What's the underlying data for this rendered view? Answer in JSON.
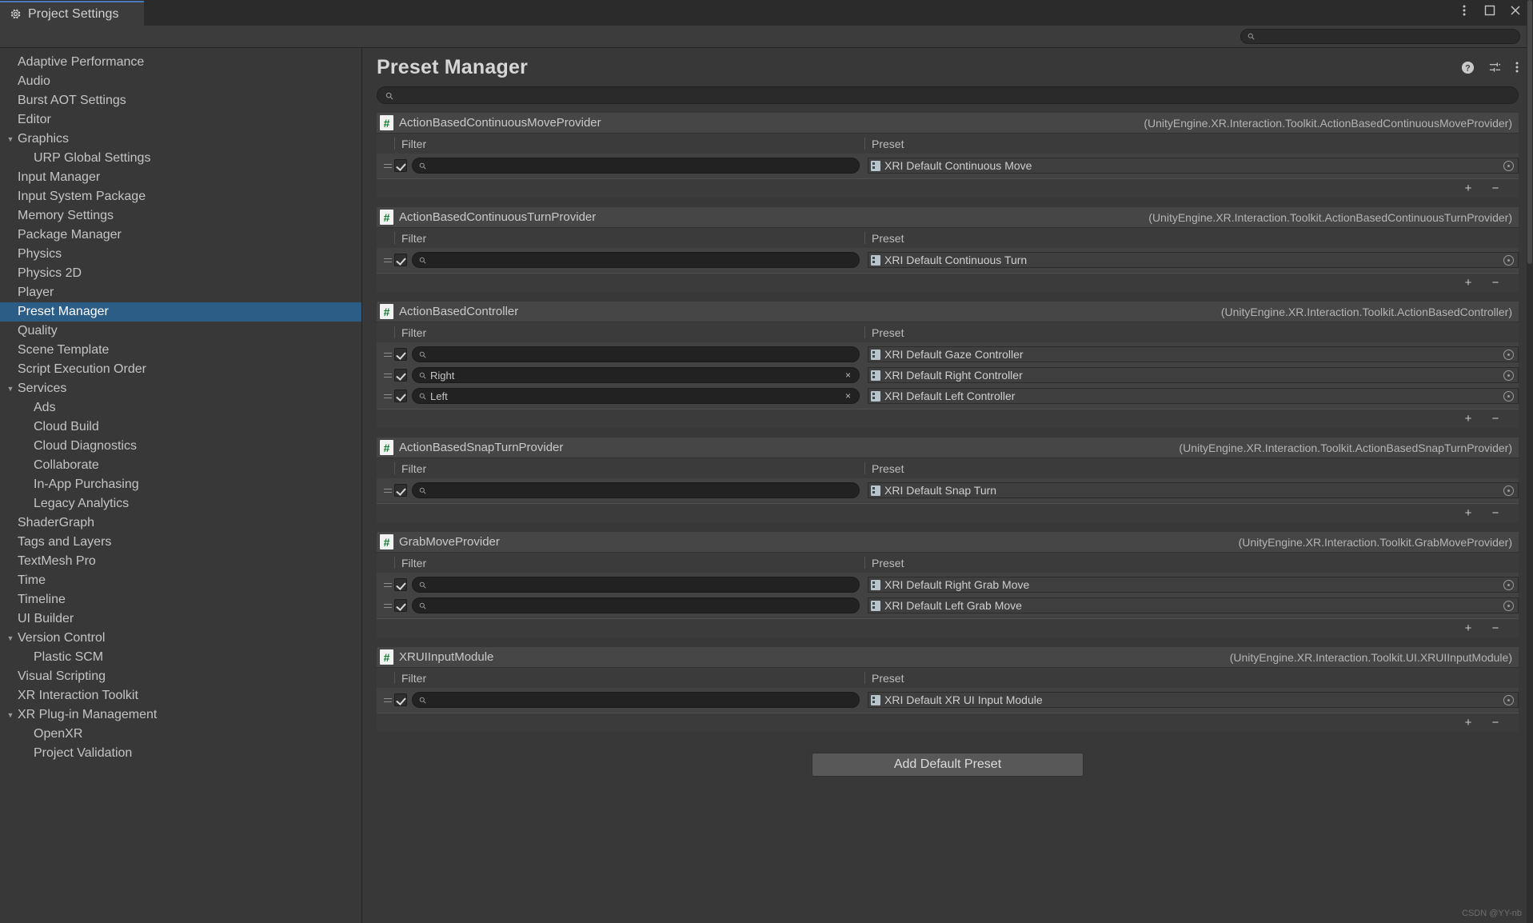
{
  "window": {
    "tab_label": "Project Settings",
    "gear_icon": "gear-icon",
    "menu_icon": "kebab-menu-icon",
    "maximize_icon": "maximize-icon",
    "close_icon": "close-icon"
  },
  "toolbar": {
    "search_value": "",
    "search_placeholder": "",
    "search_icon": "search-icon"
  },
  "header": {
    "title": "Preset Manager",
    "help_icon": "help-icon",
    "settings_icon": "preferences-icon",
    "more_icon": "kebab-menu-icon"
  },
  "panel_search": {
    "value": "",
    "placeholder": "",
    "icon": "search-icon"
  },
  "sidebar": {
    "items": [
      {
        "label": "Adaptive Performance",
        "depth": 0,
        "arrow": "",
        "selected": false
      },
      {
        "label": "Audio",
        "depth": 0,
        "arrow": "",
        "selected": false
      },
      {
        "label": "Burst AOT Settings",
        "depth": 0,
        "arrow": "",
        "selected": false
      },
      {
        "label": "Editor",
        "depth": 0,
        "arrow": "",
        "selected": false
      },
      {
        "label": "Graphics",
        "depth": 0,
        "arrow": "▼",
        "selected": false
      },
      {
        "label": "URP Global Settings",
        "depth": 1,
        "arrow": "",
        "selected": false
      },
      {
        "label": "Input Manager",
        "depth": 0,
        "arrow": "",
        "selected": false
      },
      {
        "label": "Input System Package",
        "depth": 0,
        "arrow": "",
        "selected": false
      },
      {
        "label": "Memory Settings",
        "depth": 0,
        "arrow": "",
        "selected": false
      },
      {
        "label": "Package Manager",
        "depth": 0,
        "arrow": "",
        "selected": false
      },
      {
        "label": "Physics",
        "depth": 0,
        "arrow": "",
        "selected": false
      },
      {
        "label": "Physics 2D",
        "depth": 0,
        "arrow": "",
        "selected": false
      },
      {
        "label": "Player",
        "depth": 0,
        "arrow": "",
        "selected": false
      },
      {
        "label": "Preset Manager",
        "depth": 0,
        "arrow": "",
        "selected": true
      },
      {
        "label": "Quality",
        "depth": 0,
        "arrow": "",
        "selected": false
      },
      {
        "label": "Scene Template",
        "depth": 0,
        "arrow": "",
        "selected": false
      },
      {
        "label": "Script Execution Order",
        "depth": 0,
        "arrow": "",
        "selected": false
      },
      {
        "label": "Services",
        "depth": 0,
        "arrow": "▼",
        "selected": false
      },
      {
        "label": "Ads",
        "depth": 1,
        "arrow": "",
        "selected": false
      },
      {
        "label": "Cloud Build",
        "depth": 1,
        "arrow": "",
        "selected": false
      },
      {
        "label": "Cloud Diagnostics",
        "depth": 1,
        "arrow": "",
        "selected": false
      },
      {
        "label": "Collaborate",
        "depth": 1,
        "arrow": "",
        "selected": false
      },
      {
        "label": "In-App Purchasing",
        "depth": 1,
        "arrow": "",
        "selected": false
      },
      {
        "label": "Legacy Analytics",
        "depth": 1,
        "arrow": "",
        "selected": false
      },
      {
        "label": "ShaderGraph",
        "depth": 0,
        "arrow": "",
        "selected": false
      },
      {
        "label": "Tags and Layers",
        "depth": 0,
        "arrow": "",
        "selected": false
      },
      {
        "label": "TextMesh Pro",
        "depth": 0,
        "arrow": "",
        "selected": false
      },
      {
        "label": "Time",
        "depth": 0,
        "arrow": "",
        "selected": false
      },
      {
        "label": "Timeline",
        "depth": 0,
        "arrow": "",
        "selected": false
      },
      {
        "label": "UI Builder",
        "depth": 0,
        "arrow": "",
        "selected": false
      },
      {
        "label": "Version Control",
        "depth": 0,
        "arrow": "▼",
        "selected": false
      },
      {
        "label": "Plastic SCM",
        "depth": 1,
        "arrow": "",
        "selected": false
      },
      {
        "label": "Visual Scripting",
        "depth": 0,
        "arrow": "",
        "selected": false
      },
      {
        "label": "XR Interaction Toolkit",
        "depth": 0,
        "arrow": "",
        "selected": false
      },
      {
        "label": "XR Plug-in Management",
        "depth": 0,
        "arrow": "▼",
        "selected": false
      },
      {
        "label": "OpenXR",
        "depth": 1,
        "arrow": "",
        "selected": false
      },
      {
        "label": "Project Validation",
        "depth": 1,
        "arrow": "",
        "selected": false
      }
    ]
  },
  "columns": {
    "filter": "Filter",
    "preset": "Preset"
  },
  "row_controls": {
    "add": "+",
    "remove": "−"
  },
  "groups": [
    {
      "icon": "cs-script-icon",
      "glyph": "#",
      "title": "ActionBasedContinuousMoveProvider",
      "type": "(UnityEngine.XR.Interaction.Toolkit.ActionBasedContinuousMoveProvider)",
      "rows": [
        {
          "enabled": true,
          "filter": "",
          "has_clear": false,
          "preset": "XRI Default Continuous Move"
        }
      ]
    },
    {
      "icon": "cs-script-icon",
      "glyph": "#",
      "title": "ActionBasedContinuousTurnProvider",
      "type": "(UnityEngine.XR.Interaction.Toolkit.ActionBasedContinuousTurnProvider)",
      "rows": [
        {
          "enabled": true,
          "filter": "",
          "has_clear": false,
          "preset": "XRI Default Continuous Turn"
        }
      ]
    },
    {
      "icon": "cs-script-icon",
      "glyph": "#",
      "title": "ActionBasedController",
      "type": "(UnityEngine.XR.Interaction.Toolkit.ActionBasedController)",
      "rows": [
        {
          "enabled": true,
          "filter": "",
          "has_clear": false,
          "preset": "XRI Default Gaze Controller"
        },
        {
          "enabled": true,
          "filter": "Right",
          "has_clear": true,
          "preset": "XRI Default Right Controller"
        },
        {
          "enabled": true,
          "filter": "Left",
          "has_clear": true,
          "preset": "XRI Default Left Controller"
        }
      ]
    },
    {
      "icon": "cs-script-icon",
      "glyph": "#",
      "title": "ActionBasedSnapTurnProvider",
      "type": "(UnityEngine.XR.Interaction.Toolkit.ActionBasedSnapTurnProvider)",
      "rows": [
        {
          "enabled": true,
          "filter": "",
          "has_clear": false,
          "preset": "XRI Default Snap Turn"
        }
      ]
    },
    {
      "icon": "cs-script-icon",
      "glyph": "#",
      "title": "GrabMoveProvider",
      "type": "(UnityEngine.XR.Interaction.Toolkit.GrabMoveProvider)",
      "rows": [
        {
          "enabled": true,
          "filter": "",
          "has_clear": false,
          "preset": "XRI Default Right Grab Move"
        },
        {
          "enabled": true,
          "filter": "",
          "has_clear": false,
          "preset": "XRI Default Left Grab Move"
        }
      ]
    },
    {
      "icon": "cs-script-icon",
      "glyph": "#",
      "title": "XRUIInputModule",
      "type": "(UnityEngine.XR.Interaction.Toolkit.UI.XRUIInputModule)",
      "rows": [
        {
          "enabled": true,
          "filter": "",
          "has_clear": false,
          "preset": "XRI Default XR UI Input Module"
        }
      ]
    }
  ],
  "footer": {
    "add_default_preset": "Add Default Preset"
  },
  "watermark": "CSDN @YY-nb",
  "colors": {
    "background": "#383838",
    "panel": "#424242",
    "selection": "#2c5d87",
    "accent_tab": "#4a7ab8",
    "script_green": "#0f7b2e",
    "text": "#c4c4c4"
  }
}
